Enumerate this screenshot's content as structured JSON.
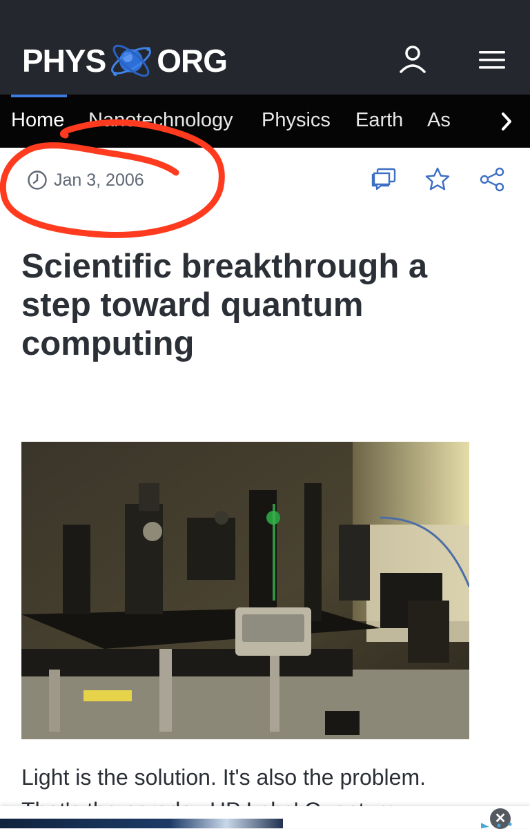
{
  "header": {
    "logo_left": "PHYS",
    "logo_right": "ORG"
  },
  "nav": {
    "items": [
      {
        "label": "Home",
        "active": true
      },
      {
        "label": "Nanotechnology",
        "active": false
      },
      {
        "label": "Physics",
        "active": false
      },
      {
        "label": "Earth",
        "active": false
      },
      {
        "label": "As",
        "active": false
      }
    ],
    "next_icon": "chevron-right-icon"
  },
  "article": {
    "date": "Jan 3, 2006",
    "title": "Scientific breakthrough a step toward quantum computing",
    "body_first_line": "Light is the solution. It's also the problem.",
    "body_second_line_partial": "That's the paradox HP Labs' Quantum"
  },
  "icons": {
    "date": "clock-icon",
    "comments": "comment-icon",
    "bookmark": "star-icon",
    "share": "share-icon",
    "user": "user-icon",
    "menu": "hamburger-menu-icon"
  },
  "ad": {
    "close_label": "✕"
  },
  "colors": {
    "header_bg": "#24272d",
    "nav_bg": "#050505",
    "accent": "#3d7be0",
    "annotation": "#ff3b1f"
  }
}
